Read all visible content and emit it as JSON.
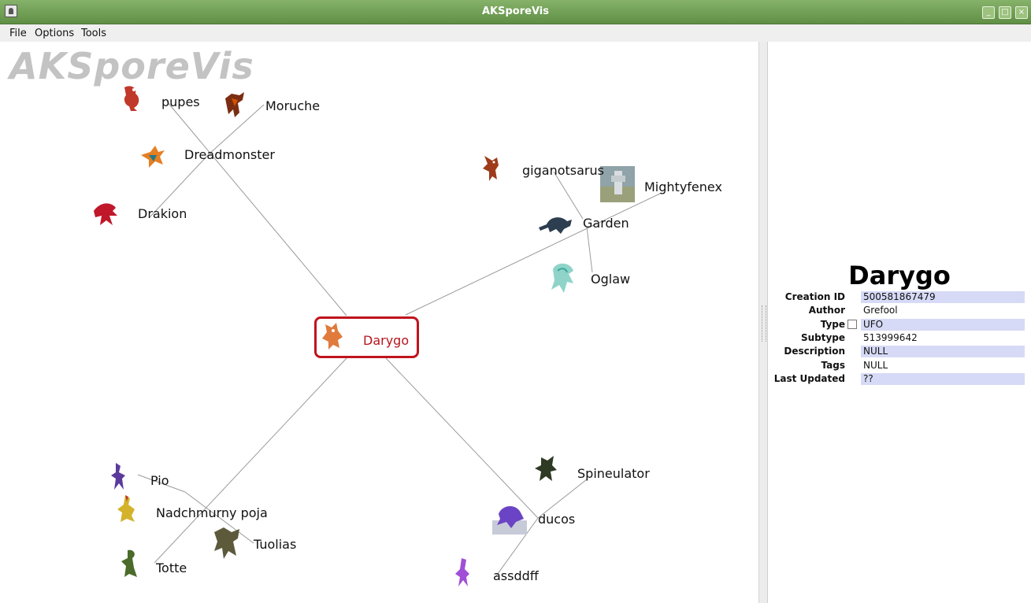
{
  "window": {
    "title": "AKSporeVis"
  },
  "menu": {
    "items": [
      "File",
      "Options",
      "Tools"
    ]
  },
  "canvas": {
    "watermark": "AKSporeVis",
    "center": {
      "name": "Darygo"
    },
    "nodes": {
      "pupes": "pupes",
      "moruche": "Moruche",
      "dreadmonster": "Dreadmonster",
      "drakion": "Drakion",
      "giganotsarus": "giganotsarus",
      "mightyfenex": "Mightyfenex",
      "garden": "Garden",
      "oglaw": "Oglaw",
      "pio": "Pio",
      "nadchmurny": "Nadchmurny poja",
      "tuolias": "Tuolias",
      "totte": "Totte",
      "spineulator": "Spineulator",
      "ducos": "ducos",
      "assddff": "assddff"
    }
  },
  "details": {
    "title": "Darygo",
    "creation_id_label": "Creation ID",
    "creation_id": "500581867479",
    "author_label": "Author",
    "author": "Grefool",
    "type_label": "Type",
    "type": "UFO",
    "subtype_label": "Subtype",
    "subtype": "513999642",
    "description_label": "Description",
    "description": "NULL",
    "tags_label": "Tags",
    "tags": "NULL",
    "last_updated_label": "Last Updated",
    "last_updated": "??"
  }
}
